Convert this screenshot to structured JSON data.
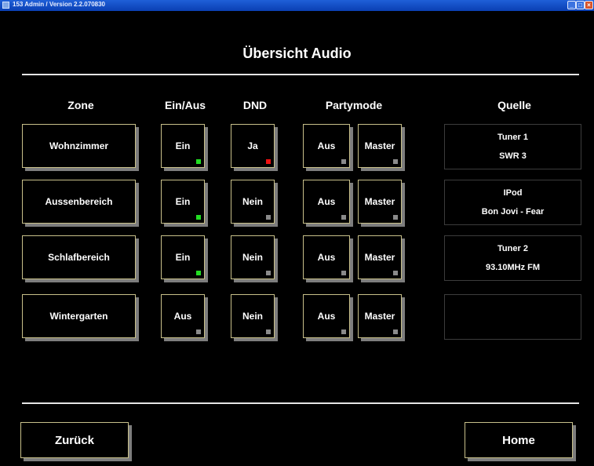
{
  "window": {
    "title": "153 Admin / Version 2.2.070830"
  },
  "page": {
    "title": "Übersicht Audio"
  },
  "columns": {
    "zone": "Zone",
    "einaus": "Ein/Aus",
    "dnd": "DND",
    "partymode": "Partymode",
    "quelle": "Quelle"
  },
  "rows": [
    {
      "zone": "Wohnzimmer",
      "einaus": "Ein",
      "einaus_led": "green",
      "dnd": "Ja",
      "dnd_led": "red",
      "party": "Aus",
      "party_led": "gray",
      "master": "Master",
      "master_led": "gray",
      "quelle_line1": "Tuner 1",
      "quelle_line2": "SWR 3"
    },
    {
      "zone": "Aussenbereich",
      "einaus": "Ein",
      "einaus_led": "green",
      "dnd": "Nein",
      "dnd_led": "gray",
      "party": "Aus",
      "party_led": "gray",
      "master": "Master",
      "master_led": "gray",
      "quelle_line1": "IPod",
      "quelle_line2": "Bon Jovi - Fear"
    },
    {
      "zone": "Schlafbereich",
      "einaus": "Ein",
      "einaus_led": "green",
      "dnd": "Nein",
      "dnd_led": "gray",
      "party": "Aus",
      "party_led": "gray",
      "master": "Master",
      "master_led": "gray",
      "quelle_line1": "Tuner 2",
      "quelle_line2": "93.10MHz FM"
    },
    {
      "zone": "Wintergarten",
      "einaus": "Aus",
      "einaus_led": "gray",
      "dnd": "Nein",
      "dnd_led": "gray",
      "party": "Aus",
      "party_led": "gray",
      "master": "Master",
      "master_led": "gray",
      "quelle_line1": "",
      "quelle_line2": ""
    }
  ],
  "footer": {
    "back_label": "Zurück",
    "home_label": "Home"
  },
  "colors": {
    "led_on": "#22dd22",
    "led_red": "#ee1111",
    "led_off": "#8a8a8a",
    "button_border": "#c8c08a",
    "button_shadow": "#7d7d7d"
  },
  "icons": {
    "window_icon": "app-icon",
    "minimize": "minimize-icon",
    "maximize": "maximize-icon",
    "close": "close-icon"
  }
}
